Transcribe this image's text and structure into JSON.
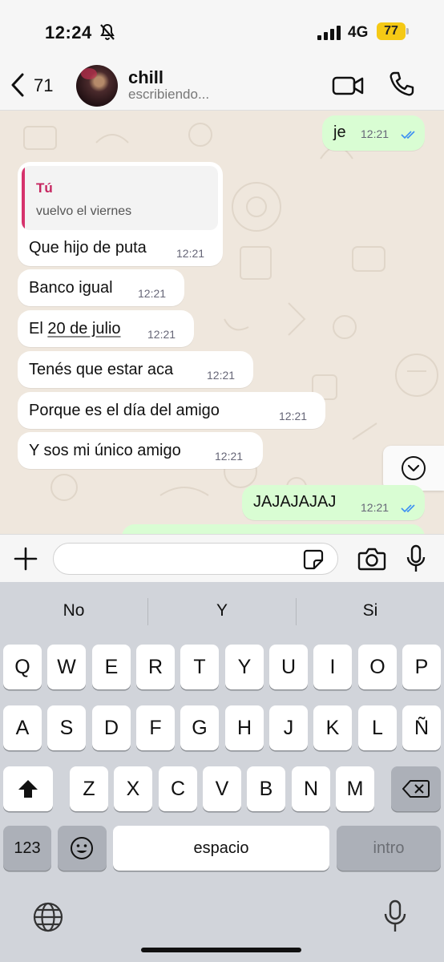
{
  "status_bar": {
    "time": "12:24",
    "network": "4G",
    "battery": "77",
    "icons": [
      "bell-slash-icon",
      "signal-bars-icon"
    ]
  },
  "header": {
    "back_count": "71",
    "contact_name": "chill",
    "contact_status": "escribiendo...",
    "icons": [
      "chevron-left-icon",
      "video-call-icon",
      "phone-icon"
    ]
  },
  "messages": [
    {
      "dir": "out",
      "text": "je",
      "time": "12:21",
      "read": true
    },
    {
      "dir": "in",
      "quote_author": "Tú",
      "quote_text": "vuelvo el viernes",
      "text": "Que hijo de puta",
      "time": "12:21"
    },
    {
      "dir": "in",
      "text": "Banco igual",
      "time": "12:21"
    },
    {
      "dir": "in",
      "text_prefix": "El ",
      "text_link": "20 de julio",
      "time": "12:21"
    },
    {
      "dir": "in",
      "text": "Tenés que estar aca",
      "time": "12:21"
    },
    {
      "dir": "in",
      "text": "Porque es el día del amigo",
      "time": "12:21"
    },
    {
      "dir": "in",
      "text": "Y sos mi único amigo",
      "time": "12:21"
    },
    {
      "dir": "out",
      "text": "JAJAJAJAJ",
      "time": "12:21",
      "read": true
    }
  ],
  "input": {
    "placeholder": "",
    "value": "",
    "icons": [
      "plus-icon",
      "sticker-icon",
      "camera-icon",
      "microphone-icon"
    ]
  },
  "keyboard": {
    "suggestions": [
      "No",
      "Y",
      "Si"
    ],
    "row1": [
      "Q",
      "W",
      "E",
      "R",
      "T",
      "Y",
      "U",
      "I",
      "O",
      "P"
    ],
    "row2": [
      "A",
      "S",
      "D",
      "F",
      "G",
      "H",
      "J",
      "K",
      "L",
      "Ñ"
    ],
    "row3": [
      "Z",
      "X",
      "C",
      "V",
      "B",
      "N",
      "M"
    ],
    "numbers_label": "123",
    "space_label": "espacio",
    "return_label": "intro",
    "icons": [
      "shift-icon",
      "backspace-icon",
      "emoji-icon",
      "globe-icon",
      "dictation-icon"
    ]
  },
  "colors": {
    "outgoing_bubble": "#d9fdd3",
    "incoming_bubble": "#ffffff",
    "chat_bg": "#efe7dd",
    "read_ticks": "#3b8ef3",
    "quote_accent": "#c6255f",
    "battery": "#f5c915"
  }
}
